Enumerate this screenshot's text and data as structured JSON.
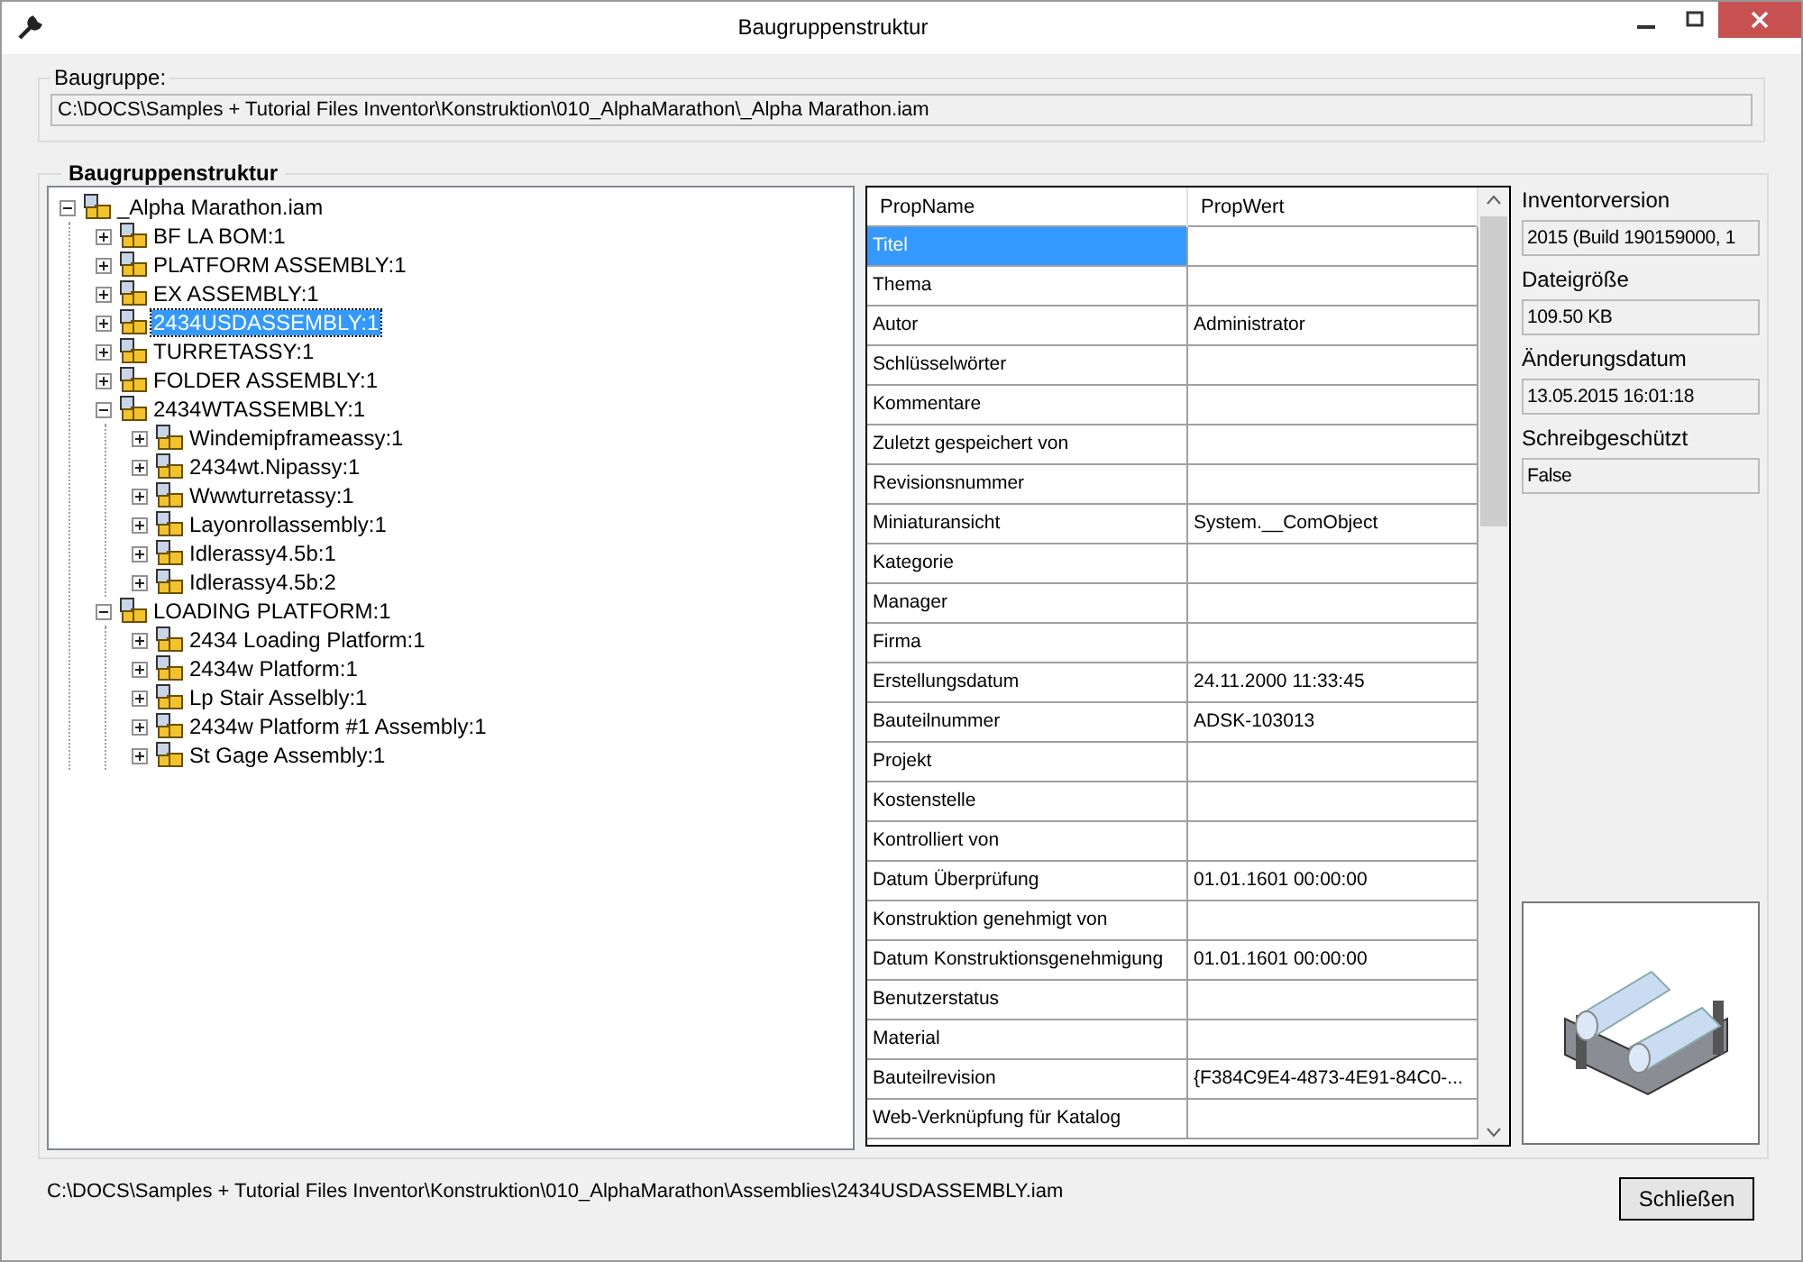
{
  "window": {
    "title": "Baugruppenstruktur"
  },
  "assembly": {
    "label": "Baugruppe:",
    "path": "C:\\DOCS\\Samples + Tutorial Files Inventor\\Konstruktion\\010_AlphaMarathon\\_Alpha Marathon.iam"
  },
  "structure": {
    "title": "Baugruppenstruktur",
    "tree": [
      {
        "label": "_Alpha Marathon.iam",
        "expanded": true,
        "selected": false,
        "children": [
          {
            "label": "BF LA BOM:1",
            "expanded": false,
            "selected": false
          },
          {
            "label": "PLATFORM ASSEMBLY:1",
            "expanded": false,
            "selected": false
          },
          {
            "label": "EX ASSEMBLY:1",
            "expanded": false,
            "selected": false
          },
          {
            "label": "2434USDASSEMBLY:1",
            "expanded": false,
            "selected": true
          },
          {
            "label": "TURRETASSY:1",
            "expanded": false,
            "selected": false
          },
          {
            "label": "FOLDER ASSEMBLY:1",
            "expanded": false,
            "selected": false
          },
          {
            "label": "2434WTASSEMBLY:1",
            "expanded": true,
            "selected": false,
            "children": [
              {
                "label": "Windemipframeassy:1",
                "expanded": false,
                "selected": false
              },
              {
                "label": "2434wt.Nipassy:1",
                "expanded": false,
                "selected": false
              },
              {
                "label": "Wwwturretassy:1",
                "expanded": false,
                "selected": false
              },
              {
                "label": "Layonrollassembly:1",
                "expanded": false,
                "selected": false
              },
              {
                "label": "Idlerassy4.5b:1",
                "expanded": false,
                "selected": false
              },
              {
                "label": "Idlerassy4.5b:2",
                "expanded": false,
                "selected": false
              }
            ]
          },
          {
            "label": "LOADING PLATFORM:1",
            "expanded": true,
            "selected": false,
            "children": [
              {
                "label": "2434 Loading Platform:1",
                "expanded": false,
                "selected": false
              },
              {
                "label": "2434w Platform:1",
                "expanded": false,
                "selected": false
              },
              {
                "label": "Lp Stair Asselbly:1",
                "expanded": false,
                "selected": false
              },
              {
                "label": "2434w Platform #1 Assembly:1",
                "expanded": false,
                "selected": false
              },
              {
                "label": "St Gage Assembly:1",
                "expanded": false,
                "selected": false
              }
            ]
          }
        ]
      }
    ],
    "properties": {
      "columns": [
        "PropName",
        "PropWert"
      ],
      "rows": [
        {
          "name": "Titel",
          "value": "",
          "selected": true
        },
        {
          "name": "Thema",
          "value": "",
          "selected": false
        },
        {
          "name": "Autor",
          "value": "Administrator",
          "selected": false
        },
        {
          "name": "Schlüsselwörter",
          "value": "",
          "selected": false
        },
        {
          "name": "Kommentare",
          "value": "",
          "selected": false
        },
        {
          "name": "Zuletzt gespeichert von",
          "value": "",
          "selected": false
        },
        {
          "name": "Revisionsnummer",
          "value": "",
          "selected": false
        },
        {
          "name": "Miniaturansicht",
          "value": "System.__ComObject",
          "selected": false
        },
        {
          "name": "Kategorie",
          "value": "",
          "selected": false
        },
        {
          "name": "Manager",
          "value": "",
          "selected": false
        },
        {
          "name": "Firma",
          "value": "",
          "selected": false
        },
        {
          "name": "Erstellungsdatum",
          "value": "24.11.2000 11:33:45",
          "selected": false
        },
        {
          "name": "Bauteilnummer",
          "value": "ADSK-103013",
          "selected": false
        },
        {
          "name": "Projekt",
          "value": "",
          "selected": false
        },
        {
          "name": "Kostenstelle",
          "value": "",
          "selected": false
        },
        {
          "name": "Kontrolliert von",
          "value": "",
          "selected": false
        },
        {
          "name": "Datum Überprüfung",
          "value": "01.01.1601 00:00:00",
          "selected": false
        },
        {
          "name": "Konstruktion genehmigt von",
          "value": "",
          "selected": false
        },
        {
          "name": "Datum Konstruktionsgenehmigung",
          "value": "01.01.1601 00:00:00",
          "selected": false
        },
        {
          "name": "Benutzerstatus",
          "value": "",
          "selected": false
        },
        {
          "name": "Material",
          "value": "",
          "selected": false
        },
        {
          "name": "Bauteilrevision",
          "value": "{F384C9E4-4873-4E91-84C0-...",
          "selected": false
        },
        {
          "name": "Web-Verknüpfung für Katalog",
          "value": "",
          "selected": false
        }
      ]
    },
    "info": [
      {
        "label": "Inventorversion",
        "value": "2015 (Build 190159000, 1"
      },
      {
        "label": "Dateigröße",
        "value": "109.50 KB"
      },
      {
        "label": "Änderungsdatum",
        "value": "13.05.2015 16:01:18"
      },
      {
        "label": "Schreibgeschützt",
        "value": "False"
      }
    ]
  },
  "status_bar": {
    "path": "C:\\DOCS\\Samples + Tutorial Files Inventor\\Konstruktion\\010_AlphaMarathon\\Assemblies\\2434USDASSEMBLY.iam"
  },
  "buttons": [
    "Schließen"
  ]
}
